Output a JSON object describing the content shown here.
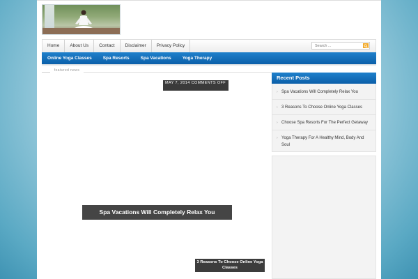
{
  "logo": {
    "alt_icon": "yoga-logo-image"
  },
  "nav": {
    "items": [
      "Home",
      "About Us",
      "Contact",
      "Disclaimer",
      "Privacy Policy"
    ]
  },
  "search": {
    "placeholder": "Search ...",
    "icon": "search-icon"
  },
  "category_nav": {
    "items": [
      "Online Yoga Classes",
      "Spa Resorts",
      "Spa Vacations",
      "Yoga Therapy"
    ]
  },
  "featured": {
    "label": "featured news"
  },
  "slider": {
    "date_badge": "MAY 7, 2014 COMMENTS OFF",
    "title": "Spa Vacations Will Completely Relax You",
    "thumb_title": "3 Reasons To Choose Online Yoga Classes"
  },
  "sidebar": {
    "recent_title": "Recent Posts",
    "recent_posts": [
      "Spa Vacations Will Completely Relax You",
      "3 Reasons To Choose Online Yoga Classes",
      "Choose Spa Resorts For The Perfect Getaway",
      "Yoga Therapy For A Healthy Mind, Body And Soul"
    ]
  },
  "colors": {
    "accent_blue": "#0b5fa9",
    "search_button": "#f2a928",
    "caption_bg": "#454545"
  }
}
